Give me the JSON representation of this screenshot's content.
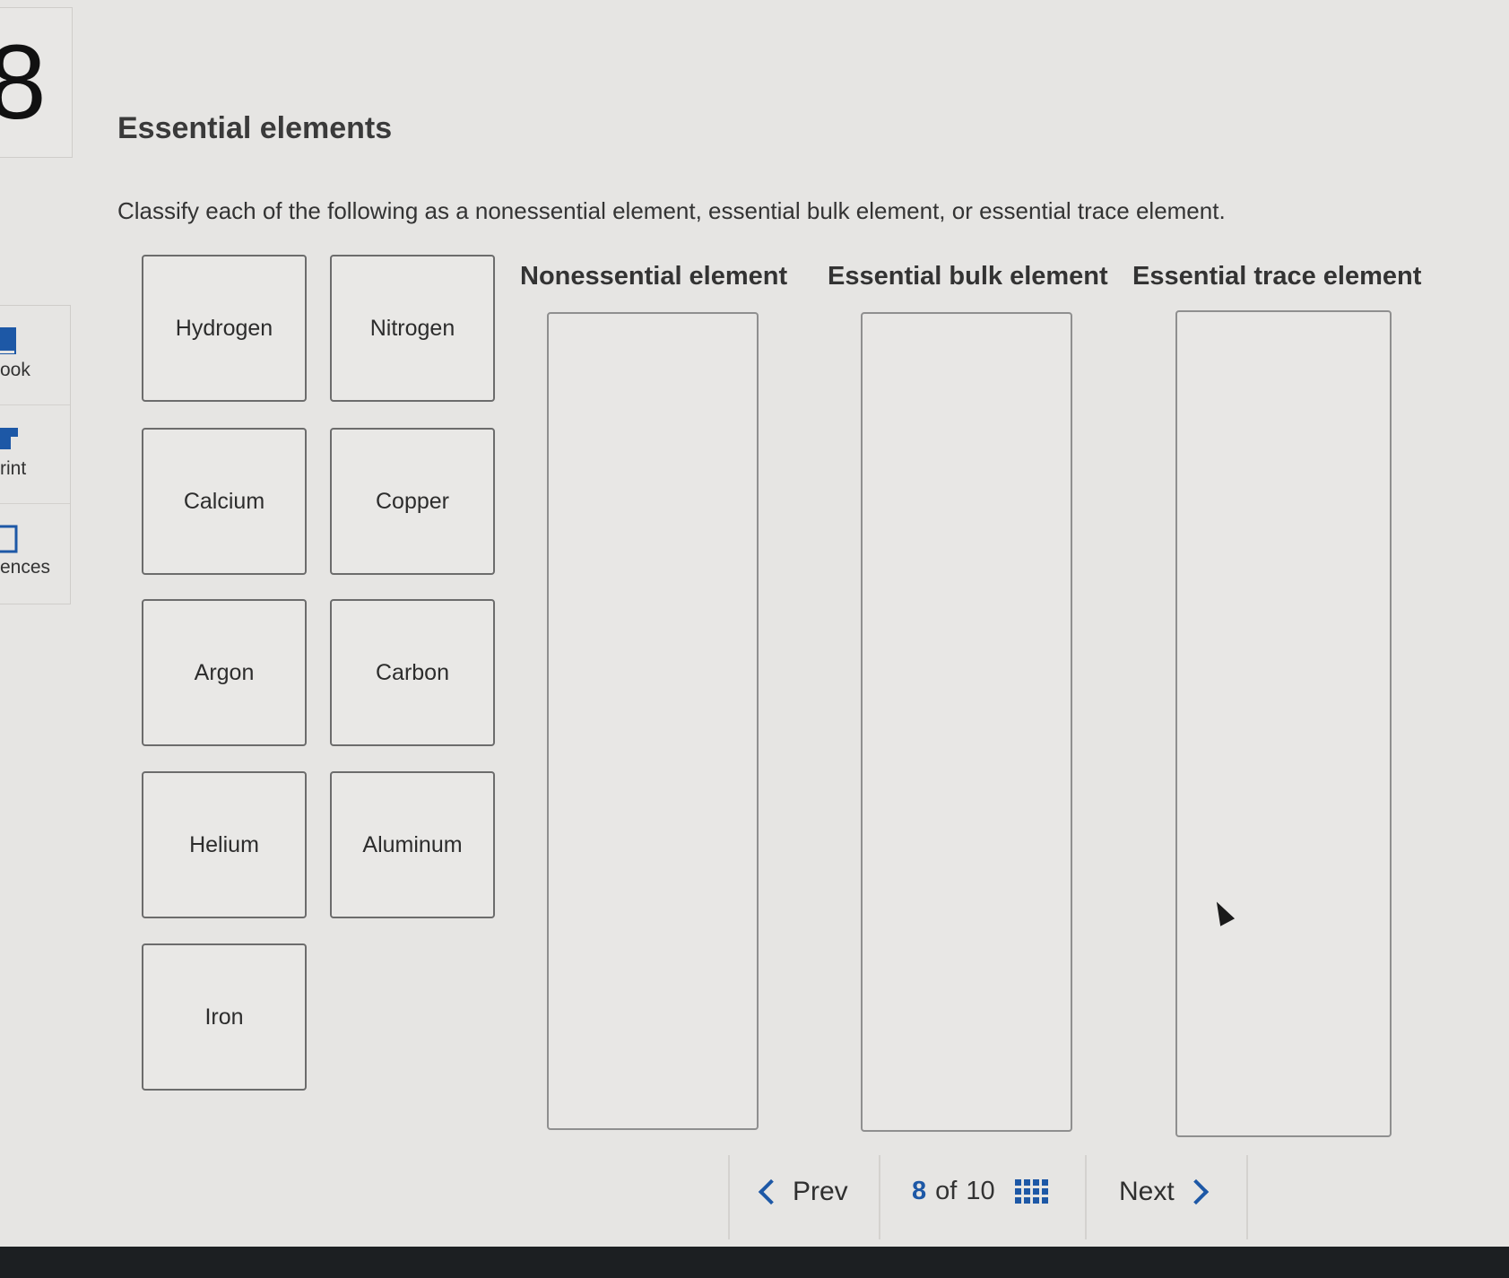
{
  "question_number": "8",
  "sidebar": {
    "items": [
      {
        "label": "ook",
        "icon": "book-icon"
      },
      {
        "label": "rint",
        "icon": "print-icon"
      },
      {
        "label": "ences",
        "icon": "references-icon"
      }
    ]
  },
  "title": "Essential elements",
  "instructions": "Classify each of the following as a nonessential element, essential bulk element, or essential trace element.",
  "tiles": [
    "Hydrogen",
    "Nitrogen",
    "Calcium",
    "Copper",
    "Argon",
    "Carbon",
    "Helium",
    "Aluminum",
    "Iron"
  ],
  "categories": [
    "Nonessential element",
    "Essential bulk element",
    "Essential trace element"
  ],
  "nav": {
    "prev_label": "Prev",
    "current": "8",
    "of_label": "of",
    "total": "10",
    "next_label": "Next"
  },
  "colors": {
    "accent": "#1d58a6",
    "background": "#e6e5e3",
    "tile_border": "#6c6c6c"
  }
}
